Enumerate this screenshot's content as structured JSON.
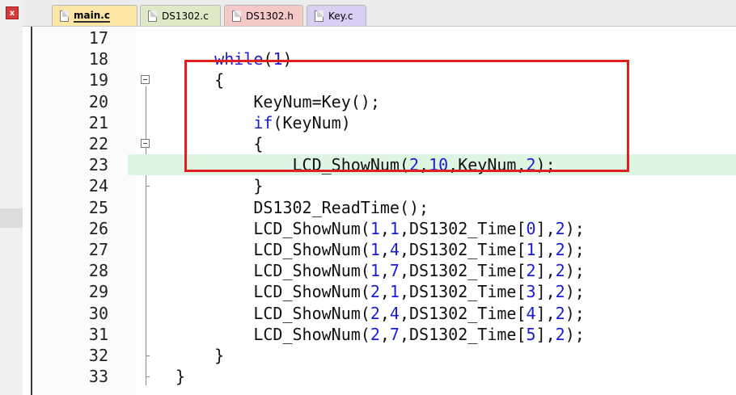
{
  "window": {
    "close_label": "x"
  },
  "tabs": [
    {
      "label": "main.c",
      "active": true
    },
    {
      "label": "DS1302.c"
    },
    {
      "label": "DS1302.h"
    },
    {
      "label": "Key.c"
    }
  ],
  "editor": {
    "lines": [
      {
        "n": "17",
        "code": ""
      },
      {
        "n": "18",
        "code": "    while(1)"
      },
      {
        "n": "19",
        "code": "    {"
      },
      {
        "n": "20",
        "code": "        KeyNum=Key();"
      },
      {
        "n": "21",
        "code": "        if(KeyNum)"
      },
      {
        "n": "22",
        "code": "        {"
      },
      {
        "n": "23",
        "code": "            LCD_ShowNum(2,10,KeyNum,2);"
      },
      {
        "n": "24",
        "code": "        }"
      },
      {
        "n": "25",
        "code": "        DS1302_ReadTime();"
      },
      {
        "n": "26",
        "code": "        LCD_ShowNum(1,1,DS1302_Time[0],2);"
      },
      {
        "n": "27",
        "code": "        LCD_ShowNum(1,4,DS1302_Time[1],2);"
      },
      {
        "n": "28",
        "code": "        LCD_ShowNum(1,7,DS1302_Time[2],2);"
      },
      {
        "n": "29",
        "code": "        LCD_ShowNum(2,1,DS1302_Time[3],2);"
      },
      {
        "n": "30",
        "code": "        LCD_ShowNum(2,4,DS1302_Time[4],2);"
      },
      {
        "n": "31",
        "code": "        LCD_ShowNum(2,7,DS1302_Time[5],2);"
      },
      {
        "n": "32",
        "code": "    }"
      },
      {
        "n": "33",
        "code": "}"
      }
    ],
    "highlighted_line": "23"
  },
  "colors": {
    "keyword": "#1b1bd6",
    "annotation_box": "#e02020",
    "line_highlight": "#def5e2"
  }
}
